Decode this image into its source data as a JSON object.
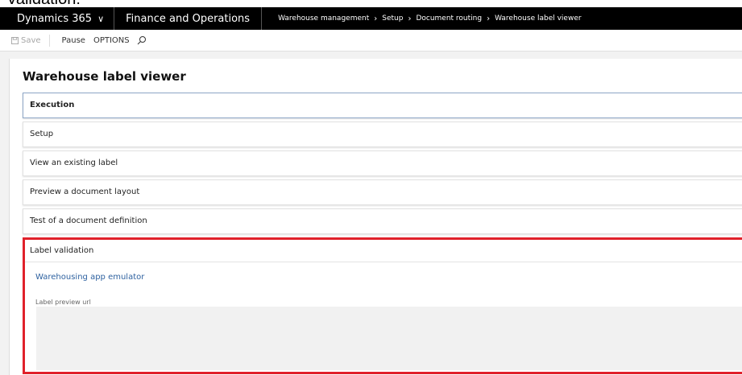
{
  "caption": "Validation:",
  "topbar": {
    "brand": "Dynamics 365",
    "app": "Finance and Operations",
    "breadcrumb": [
      "Warehouse management",
      "Setup",
      "Document routing",
      "Warehouse label viewer"
    ]
  },
  "actionbar": {
    "save_label": "Save",
    "pause_label": "Pause",
    "options_label": "OPTIONS"
  },
  "page": {
    "title": "Warehouse label viewer",
    "fasttabs": [
      {
        "label": "Execution"
      },
      {
        "label": "Setup"
      },
      {
        "label": "View an existing label"
      },
      {
        "label": "Preview a document layout"
      },
      {
        "label": "Test of a document definition"
      }
    ],
    "validation": {
      "label": "Label validation",
      "link_label": "Warehousing app emulator",
      "field_label": "Label preview url",
      "field_value": ""
    }
  },
  "colors": {
    "topbar": "#000000",
    "link": "#2f62a0",
    "highlight": "#e0212b"
  }
}
